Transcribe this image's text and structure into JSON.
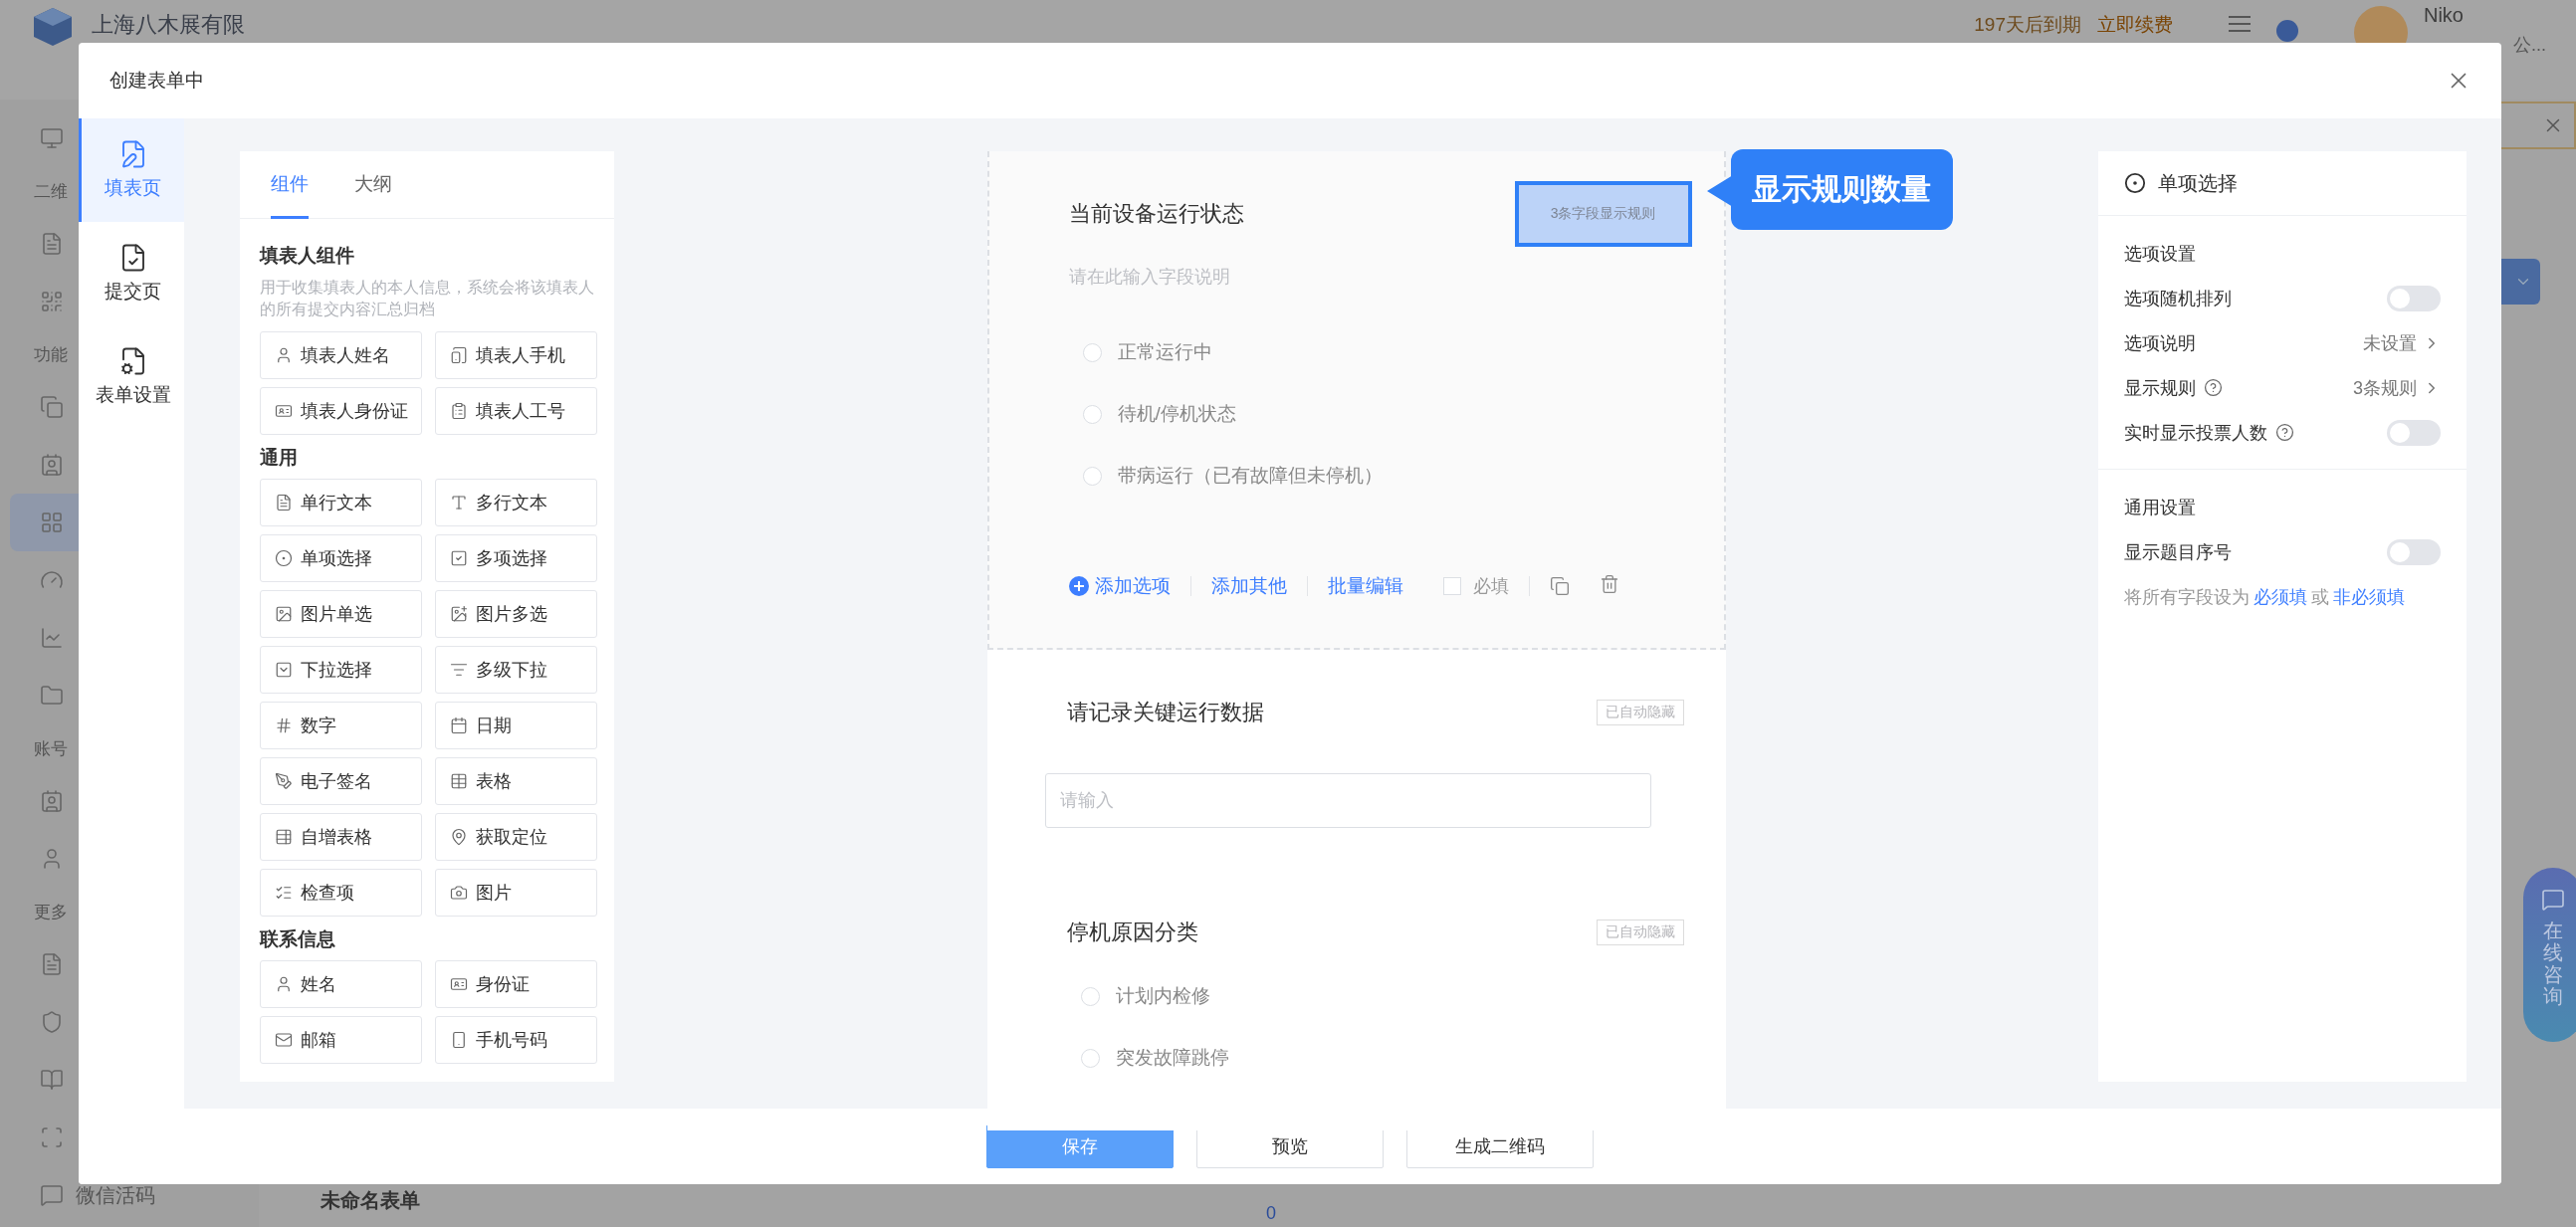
{
  "background": {
    "company": "上海八木展有限",
    "expiry": "197天后到期",
    "renew": "立即续费",
    "user": "Niko",
    "org": "公...",
    "sidebar": [
      {
        "kind": "item",
        "selected": false
      },
      {
        "kind": "heading",
        "label": "二维"
      },
      {
        "kind": "item",
        "selected": false
      },
      {
        "kind": "item",
        "selected": false
      },
      {
        "kind": "heading",
        "label": "功能"
      },
      {
        "kind": "item",
        "selected": false
      },
      {
        "kind": "item",
        "selected": false
      },
      {
        "kind": "item",
        "selected": true
      },
      {
        "kind": "item",
        "selected": false
      },
      {
        "kind": "item",
        "selected": false
      },
      {
        "kind": "item",
        "selected": false
      },
      {
        "kind": "heading",
        "label": "账号"
      },
      {
        "kind": "item",
        "selected": false
      },
      {
        "kind": "item",
        "selected": false
      },
      {
        "kind": "heading",
        "label": "更多"
      },
      {
        "kind": "item",
        "selected": false
      },
      {
        "kind": "item",
        "selected": false
      },
      {
        "kind": "item",
        "selected": false
      },
      {
        "kind": "item",
        "selected": false
      },
      {
        "kind": "item",
        "selected": false,
        "label": "微信活码"
      }
    ],
    "list_title": "未命名表单",
    "count": "0",
    "chat": "在线咨询"
  },
  "dialog": {
    "title": "创建表单中",
    "nav": [
      {
        "label": "填表页",
        "selected": true
      },
      {
        "label": "提交页",
        "selected": false
      },
      {
        "label": "表单设置",
        "selected": false
      }
    ],
    "palette": {
      "tabs": [
        {
          "label": "组件",
          "selected": true
        },
        {
          "label": "大纲",
          "selected": false
        }
      ],
      "groups": [
        {
          "title": "填表人组件",
          "note": "用于收集填表人的本人信息，系统会将该填表人的所有提交内容汇总归档",
          "items": [
            "填表人姓名",
            "填表人手机",
            "填表人身份证",
            "填表人工号"
          ]
        },
        {
          "title": "通用",
          "items": [
            "单行文本",
            "多行文本",
            "单项选择",
            "多项选择",
            "图片单选",
            "图片多选",
            "下拉选择",
            "多级下拉",
            "数字",
            "日期",
            "电子签名",
            "表格",
            "自增表格",
            "获取定位",
            "检查项",
            "图片"
          ]
        },
        {
          "title": "联系信息",
          "items": [
            "姓名",
            "身份证",
            "邮箱",
            "手机号码"
          ]
        }
      ]
    },
    "form": {
      "fields": [
        {
          "kind": "choice",
          "selected": true,
          "title": "当前设备运行状态",
          "badge": "3条字段显示规则",
          "highlighted": true,
          "description_placeholder": "请在此输入字段说明",
          "options": [
            "正常运行中",
            "待机/停机状态",
            "带病运行（已有故障但未停机）"
          ],
          "actions": [
            "添加选项",
            "添加其他",
            "批量编辑"
          ],
          "required": {
            "label": "必填",
            "checked": false
          }
        },
        {
          "kind": "text",
          "selected": false,
          "title": "请记录关键运行数据",
          "badge": "已自动隐藏",
          "highlighted": false,
          "placeholder": "请输入"
        },
        {
          "kind": "choice",
          "selected": false,
          "title": "停机原因分类",
          "badge": "已自动隐藏",
          "highlighted": false,
          "options": [
            "计划内检修",
            "突发故障跳停"
          ]
        }
      ],
      "callout": "显示规则数量"
    },
    "settings": {
      "title": "单项选择",
      "sections": [
        {
          "title": "选项设置",
          "rows": [
            {
              "kind": "toggle",
              "label": "选项随机排列",
              "help": false,
              "on": false
            },
            {
              "kind": "link",
              "label": "选项说明",
              "help": false,
              "value": "未设置"
            },
            {
              "kind": "link",
              "label": "显示规则",
              "help": true,
              "value": "3条规则"
            },
            {
              "kind": "toggle",
              "label": "实时显示投票人数",
              "help": true,
              "on": false
            }
          ]
        },
        {
          "title": "通用设置",
          "rows": [
            {
              "kind": "toggle",
              "label": "显示题目序号",
              "help": false,
              "on": false
            }
          ],
          "note": {
            "prefix": "将所有字段设为",
            "first": "必须填",
            "joiner": "或",
            "second": "非必须填"
          }
        }
      ]
    },
    "buttons": [
      {
        "label": "保存",
        "kind": "primary"
      },
      {
        "label": "预览",
        "kind": "default"
      },
      {
        "label": "生成二维码",
        "kind": "default"
      }
    ]
  }
}
